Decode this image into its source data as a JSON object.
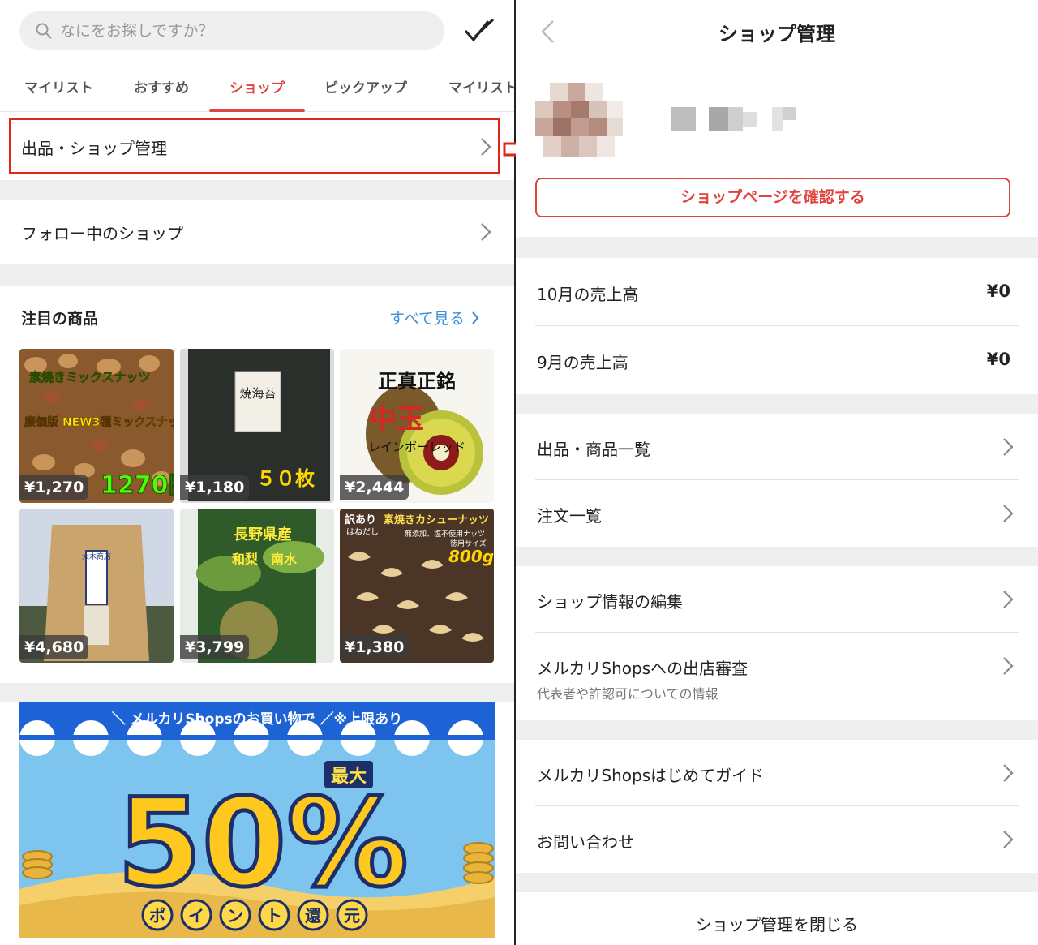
{
  "left": {
    "search": {
      "placeholder": "なにをお探しですか？"
    },
    "tabs": [
      "マイリスト",
      "おすすめ",
      "ショップ",
      "ピックアップ",
      "マイリスト"
    ],
    "active_tab": "ショップ",
    "rows": {
      "shop_manage": "出品・ショップ管理",
      "followed_shops": "フォロー中のショップ"
    },
    "featured": {
      "title": "注目の商品",
      "see_all": "すべて見る",
      "items": [
        {
          "price": "¥1,270",
          "caption": "1270円",
          "banner_text": "素焼きミックスナッツ",
          "subtext": "廉価版 NEW3種ミックスナッツ"
        },
        {
          "price": "¥1,180",
          "caption": "５０枚",
          "label": "焼海苔"
        },
        {
          "price": "¥2,444",
          "title": "正真正銘",
          "big": "中玉",
          "subtitle": "レインボーレッド"
        },
        {
          "price": "¥4,680",
          "label": "大木商店"
        },
        {
          "price": "¥3,799",
          "title": "長野県産",
          "subtitle": "和梨　南水"
        },
        {
          "price": "¥1,380",
          "tag": "訳あり",
          "tag2": "はねだし",
          "title": "素焼きカシューナッツ",
          "note": "無添加、塩不使用ナッツ",
          "note2": "徳用サイズ",
          "weight": "800g"
        }
      ]
    },
    "banner": {
      "top_text": "＼ メルカリShopsのお買い物で ／※上限あり",
      "max": "最大",
      "percent": "50%",
      "chars": [
        "ポ",
        "イ",
        "ン",
        "ト",
        "還",
        "元"
      ]
    }
  },
  "right": {
    "header": {
      "title": "ショップ管理"
    },
    "shop_page_button": "ショップページを確認する",
    "sales": [
      {
        "label": "10月の売上高",
        "value": "¥0"
      },
      {
        "label": "9月の売上高",
        "value": "¥0"
      }
    ],
    "menu1": [
      "出品・商品一覧",
      "注文一覧"
    ],
    "menu2": {
      "edit": "ショップ情報の編集",
      "review": "メルカリShopsへの出店審査",
      "review_sub": "代表者や許認可についての情報"
    },
    "menu3": [
      "メルカリShopsはじめてガイド",
      "お問い合わせ"
    ],
    "close": "ショップ管理を閉じる"
  },
  "colors": {
    "accent": "#e0443e",
    "highlight": "#e2231a",
    "link": "#3a8fd9"
  }
}
